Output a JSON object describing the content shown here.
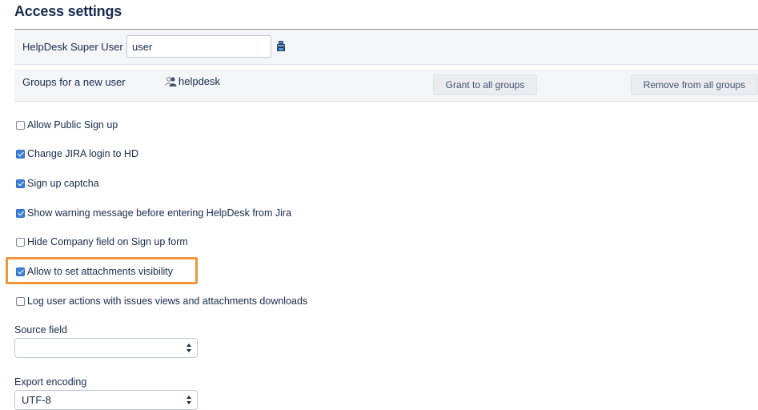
{
  "page": {
    "title": "Access settings"
  },
  "superuser": {
    "label": "HelpDesk Super User",
    "value": "user",
    "picker_icon": "user-picker-icon"
  },
  "groups": {
    "label": "Groups for a new user",
    "group_name": "helpdesk",
    "group_icon": "group-icon",
    "grant_button": "Grant to all groups",
    "remove_button": "Remove from all groups"
  },
  "options": [
    {
      "label": "Allow Public Sign up",
      "checked": false
    },
    {
      "label": "Change JIRA login to HD",
      "checked": true
    },
    {
      "label": "Sign up captcha",
      "checked": true
    },
    {
      "label": "Show warning message before entering HelpDesk from Jira",
      "checked": true
    },
    {
      "label": "Hide Company field on Sign up form",
      "checked": false
    },
    {
      "label": "Allow to set attachments visibility",
      "checked": true
    },
    {
      "label": "Log user actions with issues views and attachments downloads",
      "checked": false
    }
  ],
  "highlight_color": "#f0953a",
  "accent_color": "#3b82d6",
  "source_field": {
    "label": "Source field",
    "value": ""
  },
  "export_encoding": {
    "label": "Export encoding",
    "value": "UTF-8"
  }
}
